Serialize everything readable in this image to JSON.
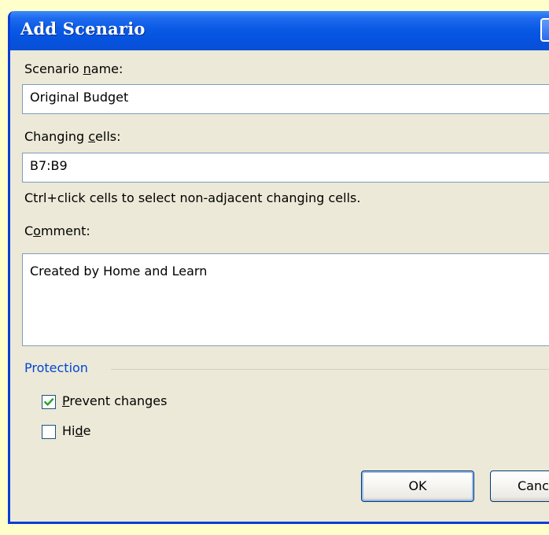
{
  "dialog": {
    "title": "Add Scenario"
  },
  "scenario_name": {
    "label_prefix": "Scenario ",
    "label_access": "n",
    "label_suffix": "ame:",
    "value": "Original Budget"
  },
  "changing_cells": {
    "label_prefix": "Changing ",
    "label_access": "c",
    "label_suffix": "ells:",
    "value": "B7:B9",
    "hint": "Ctrl+click cells to select non-adjacent changing cells."
  },
  "comment": {
    "label_prefix": "C",
    "label_access": "o",
    "label_suffix": "mment:",
    "value": "Created by Home and Learn"
  },
  "protection": {
    "group_label": "Protection",
    "prevent_changes": {
      "label_access": "P",
      "label_suffix": "revent changes",
      "checked": true
    },
    "hide": {
      "label_prefix": "Hi",
      "label_access": "d",
      "label_suffix": "e",
      "checked": false
    }
  },
  "buttons": {
    "ok": "OK",
    "cancel": "Cancel"
  },
  "colors": {
    "page_background": "#FFFFCC",
    "dialog_face": "#ECE9D8",
    "titlebar": "#0553E0",
    "group_label": "#0046D5",
    "check_mark": "#21A121"
  }
}
